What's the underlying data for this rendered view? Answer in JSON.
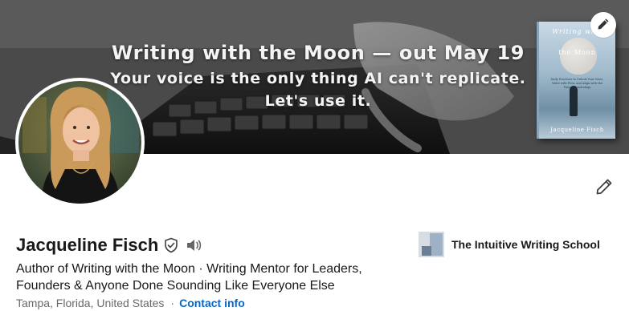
{
  "banner": {
    "line1": "Writing with the Moon — out May 19",
    "line2": "Your voice is the only thing AI can't replicate.",
    "line3": "Let's use it.",
    "book": {
      "title_top": "Writing with",
      "title_main": "the Moon",
      "subtitle": "Daily Practices to Unlock Your Voice, Write with Flow, and Align with the Power of Astrology",
      "author": "Jacqueline Fisch"
    }
  },
  "profile": {
    "name": "Jacqueline Fisch",
    "headline_line1": "Author of Writing with the Moon · Writing Mentor for Leaders,",
    "headline_line2": "Founders & Anyone Done Sounding Like Everyone Else",
    "location": "Tampa, Florida, United States",
    "separator": "·",
    "contact_label": "Contact info"
  },
  "company": {
    "name": "The Intuitive Writing School"
  },
  "icons": {
    "edit_cover": "pencil-icon",
    "edit_intro": "pencil-icon",
    "verified": "shield-check-icon",
    "pronunciation": "speaker-icon"
  },
  "colors": {
    "link": "#0a66c2",
    "text_primary": "#191919",
    "text_secondary": "#666666"
  }
}
